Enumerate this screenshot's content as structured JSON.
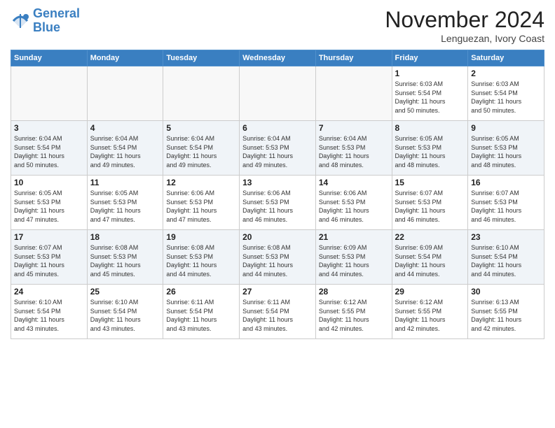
{
  "header": {
    "logo_line1": "General",
    "logo_line2": "Blue",
    "month": "November 2024",
    "location": "Lenguezan, Ivory Coast"
  },
  "weekdays": [
    "Sunday",
    "Monday",
    "Tuesday",
    "Wednesday",
    "Thursday",
    "Friday",
    "Saturday"
  ],
  "weeks": [
    [
      {
        "day": "",
        "info": ""
      },
      {
        "day": "",
        "info": ""
      },
      {
        "day": "",
        "info": ""
      },
      {
        "day": "",
        "info": ""
      },
      {
        "day": "",
        "info": ""
      },
      {
        "day": "1",
        "info": "Sunrise: 6:03 AM\nSunset: 5:54 PM\nDaylight: 11 hours\nand 50 minutes."
      },
      {
        "day": "2",
        "info": "Sunrise: 6:03 AM\nSunset: 5:54 PM\nDaylight: 11 hours\nand 50 minutes."
      }
    ],
    [
      {
        "day": "3",
        "info": "Sunrise: 6:04 AM\nSunset: 5:54 PM\nDaylight: 11 hours\nand 50 minutes."
      },
      {
        "day": "4",
        "info": "Sunrise: 6:04 AM\nSunset: 5:54 PM\nDaylight: 11 hours\nand 49 minutes."
      },
      {
        "day": "5",
        "info": "Sunrise: 6:04 AM\nSunset: 5:54 PM\nDaylight: 11 hours\nand 49 minutes."
      },
      {
        "day": "6",
        "info": "Sunrise: 6:04 AM\nSunset: 5:53 PM\nDaylight: 11 hours\nand 49 minutes."
      },
      {
        "day": "7",
        "info": "Sunrise: 6:04 AM\nSunset: 5:53 PM\nDaylight: 11 hours\nand 48 minutes."
      },
      {
        "day": "8",
        "info": "Sunrise: 6:05 AM\nSunset: 5:53 PM\nDaylight: 11 hours\nand 48 minutes."
      },
      {
        "day": "9",
        "info": "Sunrise: 6:05 AM\nSunset: 5:53 PM\nDaylight: 11 hours\nand 48 minutes."
      }
    ],
    [
      {
        "day": "10",
        "info": "Sunrise: 6:05 AM\nSunset: 5:53 PM\nDaylight: 11 hours\nand 47 minutes."
      },
      {
        "day": "11",
        "info": "Sunrise: 6:05 AM\nSunset: 5:53 PM\nDaylight: 11 hours\nand 47 minutes."
      },
      {
        "day": "12",
        "info": "Sunrise: 6:06 AM\nSunset: 5:53 PM\nDaylight: 11 hours\nand 47 minutes."
      },
      {
        "day": "13",
        "info": "Sunrise: 6:06 AM\nSunset: 5:53 PM\nDaylight: 11 hours\nand 46 minutes."
      },
      {
        "day": "14",
        "info": "Sunrise: 6:06 AM\nSunset: 5:53 PM\nDaylight: 11 hours\nand 46 minutes."
      },
      {
        "day": "15",
        "info": "Sunrise: 6:07 AM\nSunset: 5:53 PM\nDaylight: 11 hours\nand 46 minutes."
      },
      {
        "day": "16",
        "info": "Sunrise: 6:07 AM\nSunset: 5:53 PM\nDaylight: 11 hours\nand 46 minutes."
      }
    ],
    [
      {
        "day": "17",
        "info": "Sunrise: 6:07 AM\nSunset: 5:53 PM\nDaylight: 11 hours\nand 45 minutes."
      },
      {
        "day": "18",
        "info": "Sunrise: 6:08 AM\nSunset: 5:53 PM\nDaylight: 11 hours\nand 45 minutes."
      },
      {
        "day": "19",
        "info": "Sunrise: 6:08 AM\nSunset: 5:53 PM\nDaylight: 11 hours\nand 44 minutes."
      },
      {
        "day": "20",
        "info": "Sunrise: 6:08 AM\nSunset: 5:53 PM\nDaylight: 11 hours\nand 44 minutes."
      },
      {
        "day": "21",
        "info": "Sunrise: 6:09 AM\nSunset: 5:53 PM\nDaylight: 11 hours\nand 44 minutes."
      },
      {
        "day": "22",
        "info": "Sunrise: 6:09 AM\nSunset: 5:54 PM\nDaylight: 11 hours\nand 44 minutes."
      },
      {
        "day": "23",
        "info": "Sunrise: 6:10 AM\nSunset: 5:54 PM\nDaylight: 11 hours\nand 44 minutes."
      }
    ],
    [
      {
        "day": "24",
        "info": "Sunrise: 6:10 AM\nSunset: 5:54 PM\nDaylight: 11 hours\nand 43 minutes."
      },
      {
        "day": "25",
        "info": "Sunrise: 6:10 AM\nSunset: 5:54 PM\nDaylight: 11 hours\nand 43 minutes."
      },
      {
        "day": "26",
        "info": "Sunrise: 6:11 AM\nSunset: 5:54 PM\nDaylight: 11 hours\nand 43 minutes."
      },
      {
        "day": "27",
        "info": "Sunrise: 6:11 AM\nSunset: 5:54 PM\nDaylight: 11 hours\nand 43 minutes."
      },
      {
        "day": "28",
        "info": "Sunrise: 6:12 AM\nSunset: 5:55 PM\nDaylight: 11 hours\nand 42 minutes."
      },
      {
        "day": "29",
        "info": "Sunrise: 6:12 AM\nSunset: 5:55 PM\nDaylight: 11 hours\nand 42 minutes."
      },
      {
        "day": "30",
        "info": "Sunrise: 6:13 AM\nSunset: 5:55 PM\nDaylight: 11 hours\nand 42 minutes."
      }
    ]
  ]
}
